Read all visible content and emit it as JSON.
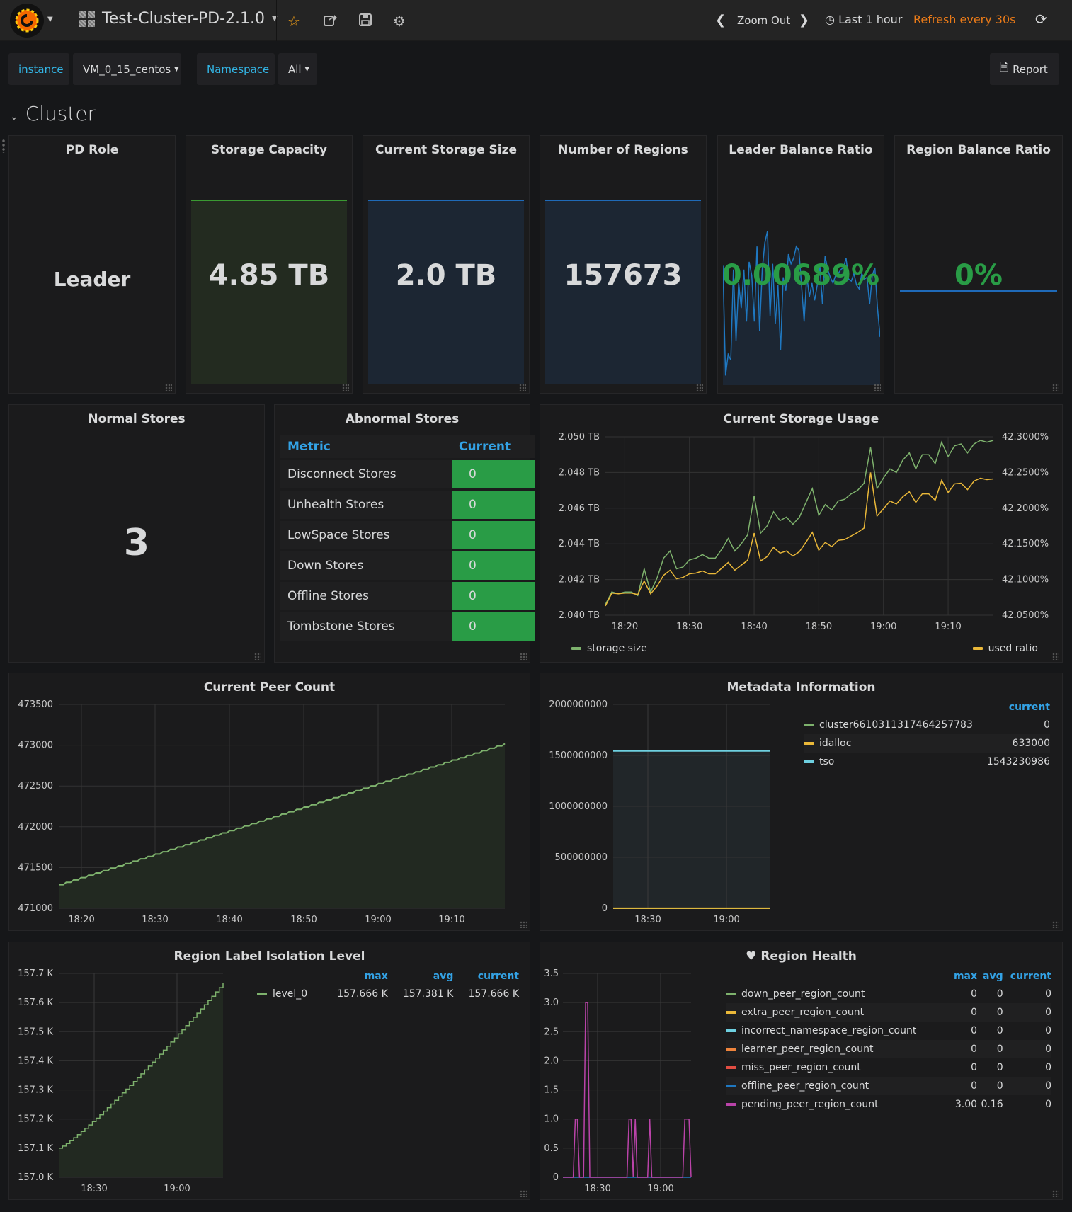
{
  "navbar": {
    "dashboard_title": "Test-Cluster-PD-2.1.0",
    "zoom_out": "Zoom Out",
    "time_range": "Last 1 hour",
    "refresh": "Refresh every 30s",
    "icons": [
      "grafana-logo-icon",
      "star-icon",
      "share-icon",
      "save-icon",
      "gear-icon",
      "chevron-left-icon",
      "chevron-right-icon",
      "clock-icon",
      "refresh-icon"
    ]
  },
  "variables": {
    "instance_label": "instance",
    "instance_value": "VM_0_15_centos",
    "namespace_label": "Namespace",
    "namespace_value": "All",
    "report_label": "Report"
  },
  "row": {
    "title": "Cluster"
  },
  "stats": {
    "pd_role": {
      "title": "PD Role",
      "value": "Leader"
    },
    "storage_capacity": {
      "title": "Storage Capacity",
      "value": "4.85 TB"
    },
    "current_storage_size": {
      "title": "Current Storage Size",
      "value": "2.0 TB"
    },
    "number_of_regions": {
      "title": "Number of Regions",
      "value": "157673"
    },
    "leader_balance_ratio": {
      "title": "Leader Balance Ratio",
      "value": "0.00689%"
    },
    "region_balance_ratio": {
      "title": "Region Balance Ratio",
      "value": "0%"
    },
    "normal_stores": {
      "title": "Normal Stores",
      "value": "3"
    }
  },
  "abnormal_stores": {
    "title": "Abnormal Stores",
    "headers": {
      "metric": "Metric",
      "current": "Current"
    },
    "rows": [
      {
        "metric": "Disconnect Stores",
        "current": "0"
      },
      {
        "metric": "Unhealth Stores",
        "current": "0"
      },
      {
        "metric": "LowSpace Stores",
        "current": "0"
      },
      {
        "metric": "Down Stores",
        "current": "0"
      },
      {
        "metric": "Offline Stores",
        "current": "0"
      },
      {
        "metric": "Tombstone Stores",
        "current": "0"
      }
    ]
  },
  "colors": {
    "green": "#7eb26d",
    "yellow": "#eab839",
    "cyan": "#6ed0e0",
    "orange": "#ef843c",
    "red": "#e24d42",
    "blue": "#1f78c1",
    "purple": "#ba43a9",
    "stat_green": "#299c46",
    "accent": "#33a2e5"
  },
  "chart_data": [
    {
      "id": "storage_usage",
      "type": "line",
      "title": "Current Storage Usage",
      "x": [
        "18:17",
        "18:18",
        "18:19",
        "18:20",
        "18:21",
        "18:22",
        "18:23",
        "18:24",
        "18:25",
        "18:26",
        "18:27",
        "18:28",
        "18:29",
        "18:30",
        "18:31",
        "18:32",
        "18:33",
        "18:34",
        "18:35",
        "18:36",
        "18:37",
        "18:38",
        "18:39",
        "18:40",
        "18:41",
        "18:42",
        "18:43",
        "18:44",
        "18:45",
        "18:46",
        "18:47",
        "18:48",
        "18:49",
        "18:50",
        "18:51",
        "18:52",
        "18:53",
        "18:54",
        "18:55",
        "18:56",
        "18:57",
        "18:58",
        "18:59",
        "19:00",
        "19:01",
        "19:02",
        "19:03",
        "19:04",
        "19:05",
        "19:06",
        "19:07",
        "19:08",
        "19:09",
        "19:10",
        "19:11",
        "19:12",
        "19:13",
        "19:14",
        "19:15",
        "19:16",
        "19:17"
      ],
      "x_ticks": [
        "18:20",
        "18:30",
        "18:40",
        "18:50",
        "19:00",
        "19:10"
      ],
      "series": [
        {
          "name": "storage size",
          "axis": "left",
          "values": [
            2.0406,
            2.0413,
            2.0412,
            2.0413,
            2.0413,
            2.0411,
            2.0426,
            2.0413,
            2.0421,
            2.0432,
            2.0436,
            2.0426,
            2.0427,
            2.0431,
            2.0432,
            2.0434,
            2.0432,
            2.0432,
            2.0437,
            2.0443,
            2.0436,
            2.044,
            2.0445,
            2.0467,
            2.0446,
            2.045,
            2.0458,
            2.0453,
            2.0455,
            2.0451,
            2.0455,
            2.0463,
            2.0471,
            2.0456,
            2.0462,
            2.0459,
            2.0464,
            2.0465,
            2.0468,
            2.047,
            2.0474,
            2.0494,
            2.0471,
            2.0477,
            2.0482,
            2.048,
            2.0487,
            2.0491,
            2.0482,
            2.049,
            2.049,
            2.0485,
            2.0497,
            2.0489,
            2.0495,
            2.0496,
            2.0491,
            2.0496,
            2.0498,
            2.0497,
            2.0498
          ]
        },
        {
          "name": "used ratio",
          "axis": "right",
          "values": [
            42.063,
            42.081,
            42.08,
            42.081,
            42.081,
            42.079,
            42.098,
            42.08,
            42.091,
            42.106,
            42.113,
            42.101,
            42.103,
            42.108,
            42.109,
            42.112,
            42.108,
            42.108,
            42.116,
            42.124,
            42.113,
            42.12,
            42.127,
            42.165,
            42.126,
            42.132,
            42.145,
            42.137,
            42.14,
            42.133,
            42.139,
            42.152,
            42.166,
            42.141,
            42.152,
            42.146,
            42.155,
            42.156,
            42.161,
            42.166,
            42.172,
            42.25,
            42.189,
            42.199,
            42.21,
            42.206,
            42.216,
            42.223,
            42.208,
            42.22,
            42.22,
            42.211,
            42.239,
            42.222,
            42.234,
            42.235,
            42.226,
            42.238,
            42.242,
            42.24,
            42.241
          ]
        }
      ],
      "y_left": {
        "min": 2.04,
        "max": 2.05,
        "ticks": [
          "2.040 TB",
          "2.042 TB",
          "2.044 TB",
          "2.046 TB",
          "2.048 TB",
          "2.050 TB"
        ]
      },
      "y_right": {
        "min": 42.05,
        "max": 42.3,
        "ticks": [
          "42.0500%",
          "42.1000%",
          "42.1500%",
          "42.2000%",
          "42.2500%",
          "42.3000%"
        ]
      },
      "legend": [
        "storage size",
        "used ratio"
      ],
      "grid": true
    },
    {
      "id": "peer_count",
      "type": "area",
      "title": "Current Peer Count",
      "x_ticks": [
        "18:20",
        "18:30",
        "18:40",
        "18:50",
        "19:00",
        "19:10"
      ],
      "series": [
        {
          "name": "peer count",
          "start": 471290,
          "end": 473020,
          "points": 61
        }
      ],
      "y_ticks": [
        "471000",
        "471500",
        "472000",
        "472500",
        "473000",
        "473500"
      ],
      "ylim": [
        471000,
        473500
      ],
      "grid": true
    },
    {
      "id": "metadata",
      "type": "area",
      "title": "Metadata Information",
      "x_ticks": [
        "18:30",
        "19:00"
      ],
      "y_ticks": [
        "0",
        "500000000",
        "1000000000",
        "1500000000",
        "2000000000"
      ],
      "ylim": [
        0,
        2000000000
      ],
      "legend_header": "current",
      "series": [
        {
          "name": "cluster6610311317464257783",
          "current": "0",
          "value": 0
        },
        {
          "name": "idalloc",
          "current": "633000",
          "value": 633000
        },
        {
          "name": "tso",
          "current": "1543230986",
          "value": 1543230986
        }
      ],
      "grid": true
    },
    {
      "id": "isolation_level",
      "type": "area",
      "title": "Region Label Isolation Level",
      "x_ticks": [
        "18:30",
        "19:00"
      ],
      "y_ticks": [
        "157.0 K",
        "157.1 K",
        "157.2 K",
        "157.3 K",
        "157.4 K",
        "157.5 K",
        "157.6 K",
        "157.7 K"
      ],
      "ylim": [
        157.0,
        157.7
      ],
      "legend_headers": [
        "max",
        "avg",
        "current"
      ],
      "series": [
        {
          "name": "level_0",
          "max": "157.666 K",
          "avg": "157.381 K",
          "current": "157.666 K",
          "start": 157.1,
          "end": 157.666
        }
      ],
      "grid": true
    },
    {
      "id": "region_health",
      "type": "line",
      "title": "Region Health",
      "x_ticks": [
        "18:30",
        "19:00"
      ],
      "y_ticks": [
        "0",
        "0.5",
        "1.0",
        "1.5",
        "2.0",
        "2.5",
        "3.0",
        "3.5"
      ],
      "ylim": [
        0,
        3.5
      ],
      "legend_headers": [
        "max",
        "avg",
        "current"
      ],
      "series": [
        {
          "name": "down_peer_region_count",
          "max": "0",
          "avg": "0",
          "current": "0"
        },
        {
          "name": "extra_peer_region_count",
          "max": "0",
          "avg": "0",
          "current": "0"
        },
        {
          "name": "incorrect_namespace_region_count",
          "max": "0",
          "avg": "0",
          "current": "0"
        },
        {
          "name": "learner_peer_region_count",
          "max": "0",
          "avg": "0",
          "current": "0"
        },
        {
          "name": "miss_peer_region_count",
          "max": "0",
          "avg": "0",
          "current": "0"
        },
        {
          "name": "offline_peer_region_count",
          "max": "0",
          "avg": "0",
          "current": "0"
        },
        {
          "name": "pending_peer_region_count",
          "max": "3.00",
          "avg": "0.16",
          "current": "0"
        }
      ],
      "pending_spikes": [
        0,
        0,
        0,
        0,
        0,
        0,
        1,
        1,
        0,
        0,
        0,
        3,
        3,
        0,
        0,
        0,
        0,
        0,
        0,
        0,
        0,
        0,
        0,
        0,
        0,
        0,
        0,
        0,
        0,
        0,
        0,
        0,
        1,
        1,
        0,
        1,
        0,
        0,
        0,
        0,
        0,
        0,
        1,
        0,
        0,
        0,
        0,
        0,
        0,
        0,
        0,
        0,
        0,
        0,
        0,
        0,
        0,
        0,
        0,
        1,
        1,
        1,
        0
      ],
      "grid": true
    }
  ]
}
